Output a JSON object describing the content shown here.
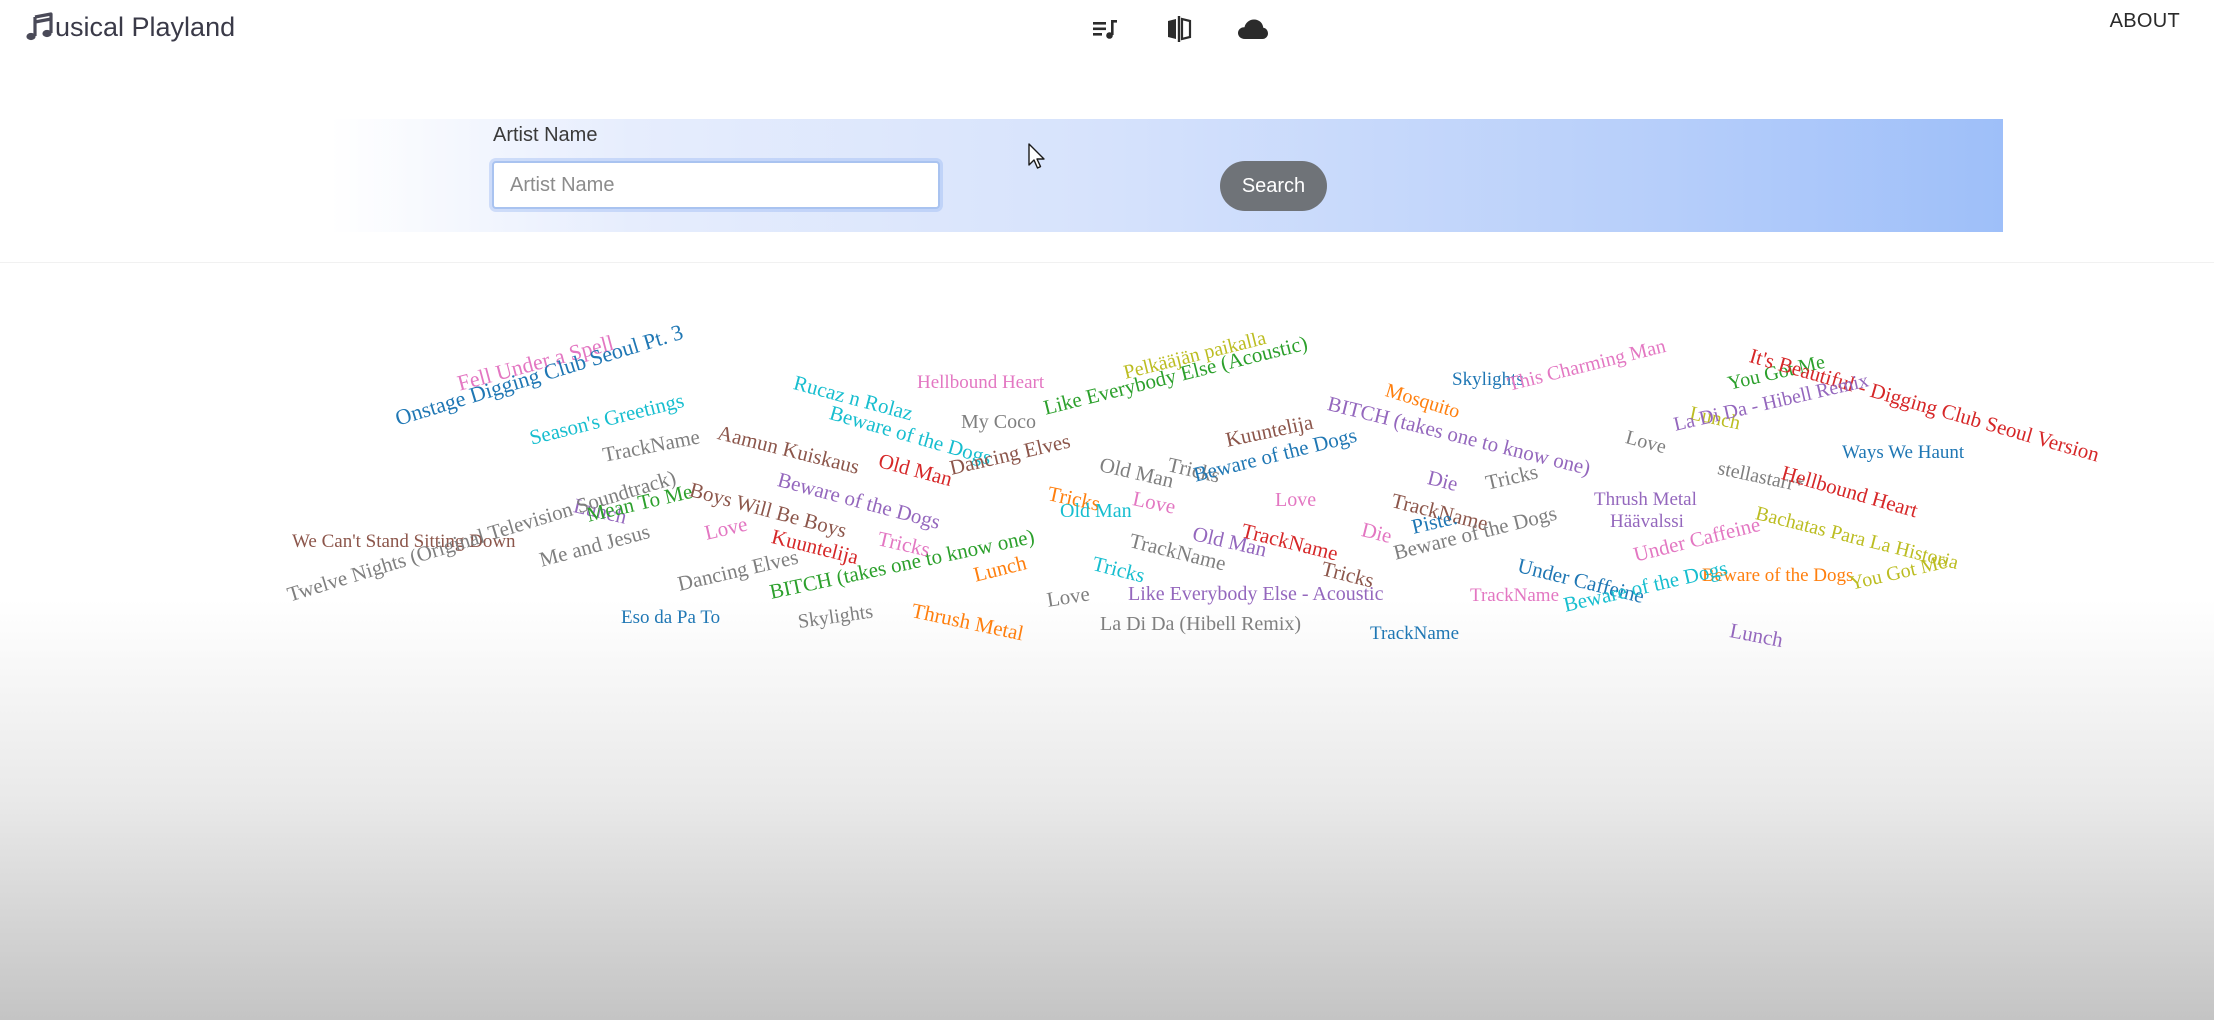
{
  "app": {
    "brand_text": "usical Playland",
    "brand_icon": "music-note-icon"
  },
  "nav": {
    "icons": [
      {
        "name": "playlist-icon"
      },
      {
        "name": "compare-icon"
      },
      {
        "name": "cloud-icon"
      }
    ],
    "about_label": "ABOUT"
  },
  "search": {
    "label": "Artist Name",
    "placeholder": "Artist Name",
    "value": "",
    "button_label": "Search"
  },
  "colors": {
    "brand_text": "#3a3a48",
    "search_button": "#6f7378",
    "band_gradient_end": "#9ebff9"
  },
  "word_cloud": {
    "words": [
      {
        "text": "Fell Under a Spell",
        "color": "#e377c2"
      },
      {
        "text": "Onstage Digging Club Seoul Pt. 3",
        "color": "#1f77b4"
      },
      {
        "text": "Season's Greetings",
        "color": "#17becf"
      },
      {
        "text": "TrackName",
        "color": "#7f7f7f"
      },
      {
        "text": "Aamun Kuiskaus",
        "color": "#8c564b"
      },
      {
        "text": "Rucaz n Rolaz",
        "color": "#17becf"
      },
      {
        "text": "Beware of the Dogs",
        "color": "#17becf"
      },
      {
        "text": "Hellbound Heart",
        "color": "#e377c2"
      },
      {
        "text": "My Coco",
        "color": "#7f7f7f"
      },
      {
        "text": "Old Man",
        "color": "#d62728"
      },
      {
        "text": "Beware of the Dogs",
        "color": "#9467bd"
      },
      {
        "text": "Pelkääjän paikalla",
        "color": "#bcbd22"
      },
      {
        "text": "Like Everybody Else (Acoustic)",
        "color": "#2ca02c"
      },
      {
        "text": "Dancing Elves",
        "color": "#8c564b"
      },
      {
        "text": "Old Man",
        "color": "#7f7f7f"
      },
      {
        "text": "Tricks",
        "color": "#7f7f7f"
      },
      {
        "text": "Kuuntelija",
        "color": "#8c564b"
      },
      {
        "text": "Beware of the Dogs",
        "color": "#1f77b4"
      },
      {
        "text": "Skylights",
        "color": "#1f77b4"
      },
      {
        "text": "Mosquito",
        "color": "#ff7f0e"
      },
      {
        "text": "BITCH (takes one to know one)",
        "color": "#9467bd"
      },
      {
        "text": "This Charming Man",
        "color": "#e377c2"
      },
      {
        "text": "Lunch",
        "color": "#bcbd22"
      },
      {
        "text": "You Got Me",
        "color": "#2ca02c"
      },
      {
        "text": "Love",
        "color": "#7f7f7f"
      },
      {
        "text": "It's Beautiful - Digging Club Seoul Version",
        "color": "#d62728"
      },
      {
        "text": "La Di Da - Hibell Remix",
        "color": "#9467bd"
      },
      {
        "text": "Ways We Haunt",
        "color": "#1f77b4"
      },
      {
        "text": "stellastarr*",
        "color": "#7f7f7f"
      },
      {
        "text": "Hellbound Heart",
        "color": "#d62728"
      },
      {
        "text": "Lunch",
        "color": "#9467bd"
      },
      {
        "text": "Mean To Me",
        "color": "#2ca02c"
      },
      {
        "text": "We Can't Stand Sitting Down",
        "color": "#8c564b"
      },
      {
        "text": "Boys Will Be Boys",
        "color": "#8c564b"
      },
      {
        "text": "Love",
        "color": "#e377c2"
      },
      {
        "text": "Kuuntelija",
        "color": "#d62728"
      },
      {
        "text": "Tricks",
        "color": "#e377c2"
      },
      {
        "text": "Me and Jesus",
        "color": "#7f7f7f"
      },
      {
        "text": "Twelve Nights (Original Television Soundtrack)",
        "color": "#7f7f7f"
      },
      {
        "text": "Dancing Elves",
        "color": "#7f7f7f"
      },
      {
        "text": "Eso da Pa To",
        "color": "#1f77b4"
      },
      {
        "text": "BITCH (takes one to know one)",
        "color": "#2ca02c"
      },
      {
        "text": "Skylights",
        "color": "#7f7f7f"
      },
      {
        "text": "Lunch",
        "color": "#ff7f0e"
      },
      {
        "text": "Thrush Metal",
        "color": "#ff7f0e"
      },
      {
        "text": "Love",
        "color": "#7f7f7f"
      },
      {
        "text": "Tricks",
        "color": "#ff7f0e"
      },
      {
        "text": "Love",
        "color": "#e377c2"
      },
      {
        "text": "Old Man",
        "color": "#17becf"
      },
      {
        "text": "TrackName",
        "color": "#7f7f7f"
      },
      {
        "text": "Old Man",
        "color": "#9467bd"
      },
      {
        "text": "TrackName",
        "color": "#d62728"
      },
      {
        "text": "Tricks",
        "color": "#17becf"
      },
      {
        "text": "Tricks",
        "color": "#8c564b"
      },
      {
        "text": "Like Everybody Else - Acoustic",
        "color": "#9467bd"
      },
      {
        "text": "La Di Da (Hibell Remix)",
        "color": "#7f7f7f"
      },
      {
        "text": "Love",
        "color": "#e377c2"
      },
      {
        "text": "Die",
        "color": "#9467bd"
      },
      {
        "text": "TrackName",
        "color": "#8c564b"
      },
      {
        "text": "Tricks",
        "color": "#7f7f7f"
      },
      {
        "text": "Die",
        "color": "#e377c2"
      },
      {
        "text": "Piste.",
        "color": "#1f77b4"
      },
      {
        "text": "Beware of the Dogs",
        "color": "#7f7f7f"
      },
      {
        "text": "TrackName",
        "color": "#1f77b4"
      },
      {
        "text": "TrackName",
        "color": "#e377c2"
      },
      {
        "text": "Thrush Metal",
        "color": "#9467bd"
      },
      {
        "text": "Häävalssi",
        "color": "#9467bd"
      },
      {
        "text": "Under Caffeine",
        "color": "#1f77b4"
      },
      {
        "text": "Under Caffeine",
        "color": "#e377c2"
      },
      {
        "text": "Beware of the Dogs",
        "color": "#ff7f0e"
      },
      {
        "text": "Beware of the Dogs",
        "color": "#17becf"
      },
      {
        "text": "Lunch",
        "color": "#9467bd"
      },
      {
        "text": "Bachatas Para La Historia",
        "color": "#bcbd22"
      },
      {
        "text": "You Got Me",
        "color": "#bcbd22"
      }
    ]
  }
}
